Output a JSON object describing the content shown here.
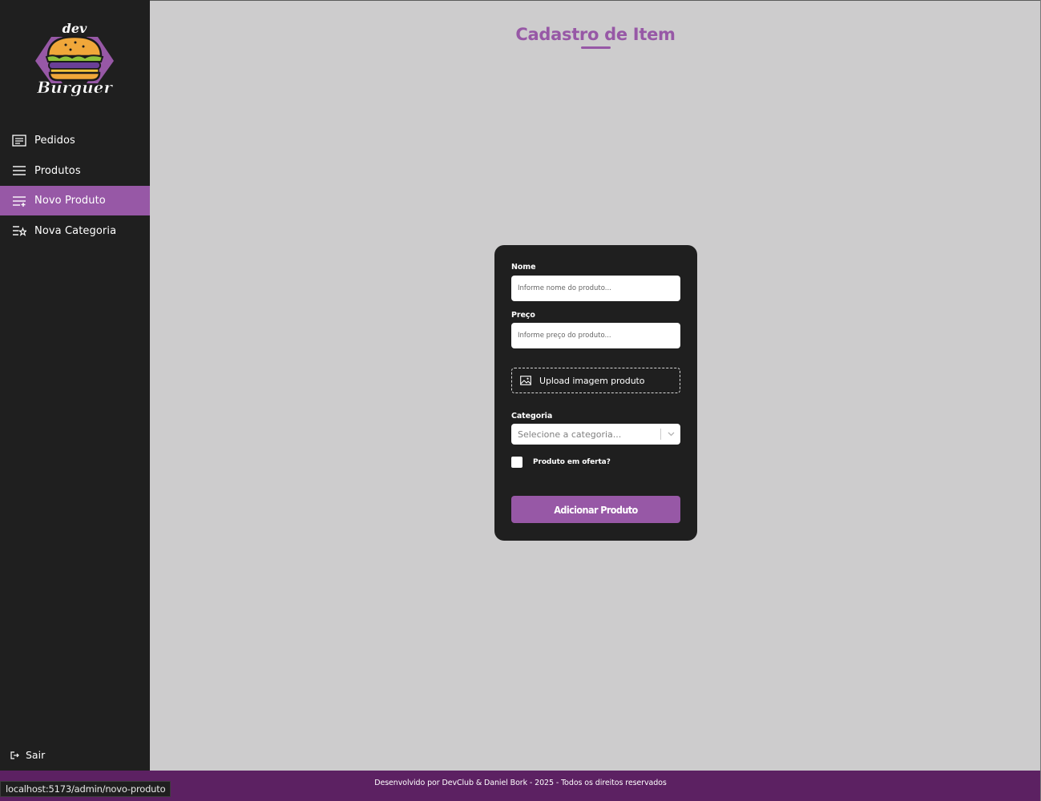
{
  "brand": {
    "logo_top": "dev",
    "logo_bottom": "Burguer"
  },
  "colors": {
    "accent": "#9758a6",
    "sidebar_bg": "#1f1f1f",
    "content_bg": "#cdcccd",
    "footer_bg": "#5c2162"
  },
  "sidebar": {
    "items": [
      {
        "label": "Pedidos",
        "icon": "receipt-icon",
        "active": false
      },
      {
        "label": "Produtos",
        "icon": "list-icon",
        "active": false
      },
      {
        "label": "Novo Produto",
        "icon": "add-list-icon",
        "active": true
      },
      {
        "label": "Nova Categoria",
        "icon": "star-list-icon",
        "active": false
      }
    ],
    "logout_label": "Sair"
  },
  "main": {
    "title": "Cadastro de Item",
    "form": {
      "name_label": "Nome",
      "name_placeholder": "Informe nome do produto...",
      "price_label": "Preço",
      "price_placeholder": "Informe preço do produto...",
      "upload_label": "Upload imagem produto",
      "category_label": "Categoria",
      "category_placeholder": "Selecione a categoria...",
      "offer_label": "Produto em oferta?",
      "offer_checked": false,
      "submit_label": "Adicionar Produto"
    }
  },
  "footer": {
    "text": "Desenvolvido por DevClub & Daniel Bork - 2025 - Todos os direitos reservados"
  },
  "status_bar": {
    "url": "localhost:5173/admin/novo-produto"
  }
}
